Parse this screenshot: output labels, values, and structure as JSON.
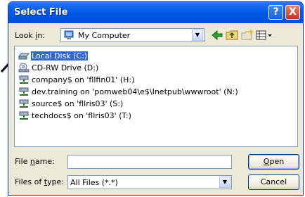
{
  "window": {
    "title": "Select File",
    "help_glyph": "?",
    "close_glyph": "X"
  },
  "toolbar": {
    "look_in_label": "Look in:",
    "look_in_label_mnemonic": "i",
    "look_in_value": "My Computer",
    "look_in_icon": "my-computer-icon",
    "tools": [
      {
        "name": "back-arrow-icon",
        "glyph": "⇦"
      },
      {
        "name": "up-folder-icon",
        "glyph": "up folder"
      },
      {
        "name": "new-folder-icon",
        "glyph": "new folder"
      },
      {
        "name": "view-menu-icon",
        "glyph": "views"
      }
    ]
  },
  "file_list": {
    "items": [
      {
        "label": "Local Disk (C:)",
        "icon": "hard-drive-icon",
        "selected": true
      },
      {
        "label": "CD-RW Drive (D:)",
        "icon": "cd-drive-icon",
        "selected": false
      },
      {
        "label": "company$ on 'fllfin01' (H:)",
        "icon": "network-drive-icon",
        "selected": false
      },
      {
        "label": "dev.training on 'pomweb04\\e$\\Inetpub\\wwwroot' (N:)",
        "icon": "network-drive-icon",
        "selected": false
      },
      {
        "label": "source$ on 'fllris03' (S:)",
        "icon": "network-drive-icon",
        "selected": false
      },
      {
        "label": "techdocs$ on 'fllris03' (T:)",
        "icon": "network-drive-icon",
        "selected": false
      }
    ]
  },
  "file_name": {
    "label_pre": "File ",
    "label_mnemonic": "n",
    "label_post": "ame:",
    "value": ""
  },
  "file_type": {
    "label_pre": "Files of ",
    "label_mnemonic": "t",
    "label_post": "ype:",
    "value": "All Files (*.*)"
  },
  "buttons": {
    "open_mnemonic": "O",
    "open_rest": "pen",
    "cancel": "Cancel"
  },
  "colors": {
    "title_bar": "#0054e3",
    "dialog_bg": "#ece9d8",
    "selection": "#316ac5",
    "border": "#7f9db9"
  }
}
